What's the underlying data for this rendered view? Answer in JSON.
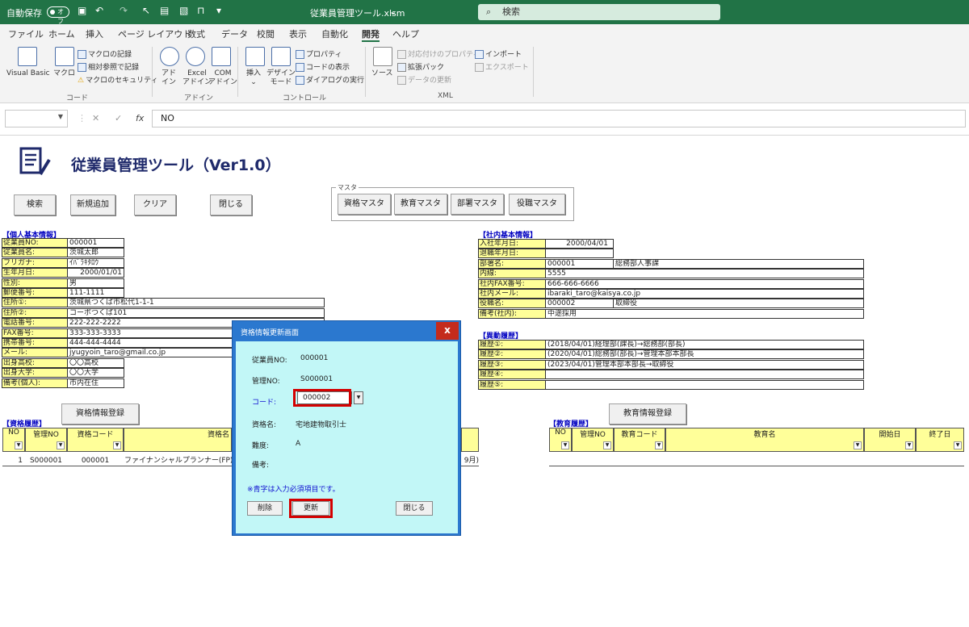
{
  "titlebar": {
    "autosave_label": "自動保存",
    "autosave_state": "オフ",
    "filename": "従業員管理ツール.xlsm",
    "search_placeholder": "検索"
  },
  "ribbon_tabs": [
    "ファイル",
    "ホーム",
    "挿入",
    "ページ レイアウト",
    "数式",
    "データ",
    "校閲",
    "表示",
    "自動化",
    "開発",
    "ヘルプ"
  ],
  "ribbon_active_tab": "開発",
  "ribbon": {
    "code": {
      "visual_basic": "Visual Basic",
      "macro": "マクロ",
      "record_macro": "マクロの記録",
      "relative_ref": "相対参照で記録",
      "macro_security": "マクロのセキュリティ",
      "group_label": "コード"
    },
    "addins": {
      "addin_l1": "アド",
      "addin_l2": "イン",
      "excel_addin_l1": "Excel",
      "excel_addin_l2": "アドイン",
      "com_addin_l1": "COM",
      "com_addin_l2": "アドイン",
      "group_label": "アドイン"
    },
    "controls": {
      "insert": "挿入",
      "design_mode_l1": "デザイン",
      "design_mode_l2": "モード",
      "properties": "プロパティ",
      "view_code": "コードの表示",
      "run_dialog": "ダイアログの実行",
      "group_label": "コントロール"
    },
    "xml": {
      "source": "ソース",
      "map_properties": "対応付けのプロパティ",
      "expansion_pack": "拡張パック",
      "refresh_data": "データの更新",
      "import": "インポート",
      "export": "エクスポート",
      "group_label": "XML"
    }
  },
  "formula_bar": {
    "cancel_glyph": "✕",
    "enter_glyph": "✓",
    "fx_label": "fx",
    "content": "NO"
  },
  "sheet": {
    "app_title": "従業員管理ツール（Ver1.0）",
    "buttons": {
      "search": "検索",
      "new": "新規追加",
      "clear": "クリア",
      "close": "閉じる"
    },
    "master_frame_label": "マスタ",
    "master_buttons": {
      "qualification": "資格マスタ",
      "education": "教育マスタ",
      "department": "部署マスタ",
      "position": "役職マスタ"
    },
    "personal": {
      "title": "【個人基本情報】",
      "rows": [
        {
          "label": "従業員NO:",
          "value": "000001"
        },
        {
          "label": "従業員名:",
          "value": "茨城太郎"
        },
        {
          "label": "フリガナ:",
          "value": "ｲﾊﾞﾗｷﾀﾛｳ"
        },
        {
          "label": "生年月日:",
          "value": "2000/01/01"
        },
        {
          "label": "性別:",
          "value": "男"
        },
        {
          "label": "郵便番号:",
          "value": "111-1111"
        },
        {
          "label": "住所①:",
          "value": "茨城県つくば市松代1-1-1"
        },
        {
          "label": "住所②:",
          "value": "コーポつくば101"
        },
        {
          "label": "電話番号:",
          "value": "222-222-2222"
        },
        {
          "label": "FAX番号:",
          "value": "333-333-3333"
        },
        {
          "label": "携帯番号:",
          "value": "444-444-4444"
        },
        {
          "label": "メール:",
          "value": "jyugyoin_taro@gmail.co.jp"
        },
        {
          "label": "出身高校:",
          "value": "〇〇高校"
        },
        {
          "label": "出身大学:",
          "value": "〇〇大学"
        },
        {
          "label": "備考(個人):",
          "value": "市内在住"
        }
      ]
    },
    "company": {
      "title": "【社内基本情報】",
      "rows": [
        {
          "label": "入社年月日:",
          "value": "2000/04/01",
          "extra": ""
        },
        {
          "label": "退職年月日:",
          "value": "",
          "extra": ""
        },
        {
          "label": "部署名:",
          "value": "000001",
          "extra": "総務部人事課"
        },
        {
          "label": "内線:",
          "value": "5555",
          "extra": ""
        },
        {
          "label": "社内FAX番号:",
          "value": "666-666-6666",
          "extra": ""
        },
        {
          "label": "社内メール:",
          "value": "ibaraki_taro@kaisya.co.jp",
          "extra": ""
        },
        {
          "label": "役職名:",
          "value": "000002",
          "extra": "取締役"
        },
        {
          "label": "備考(社内):",
          "value": "中途採用",
          "extra": ""
        }
      ]
    },
    "transfer": {
      "title": "【異動履歴】",
      "rows": [
        {
          "label": "履歴①:",
          "value": "(2018/04/01)経理部(課長)→総務部(部長)"
        },
        {
          "label": "履歴②:",
          "value": "(2020/04/01)総務部(部長)→管理本部本部長"
        },
        {
          "label": "履歴③:",
          "value": "(2023/04/01)管理本部本部長→取締役"
        },
        {
          "label": "履歴④:",
          "value": ""
        },
        {
          "label": "履歴⑤:",
          "value": ""
        }
      ]
    },
    "qual_register_btn": "資格情報登録",
    "edu_register_btn": "教育情報登録",
    "qual_history": {
      "title": "【資格履歴】",
      "headers": [
        "NO",
        "管理NO",
        "資格コード",
        "資格名"
      ],
      "row": {
        "no": "1",
        "mgmt": "S000001",
        "code": "000001",
        "name": "ファイナンシャルプランナー(FP)",
        "tail": "9月)"
      }
    },
    "edu_history": {
      "title": "【教育履歴】",
      "headers": [
        "NO",
        "管理NO",
        "教育コード",
        "教育名",
        "開始日",
        "終了日"
      ]
    }
  },
  "dialog": {
    "title": "資格情報更新画面",
    "close_glyph": "x",
    "fields": {
      "emp_no_label": "従業員NO:",
      "emp_no": "000001",
      "mgmt_no_label": "管理NO:",
      "mgmt_no": "S000001",
      "code_label": "コード:",
      "code": "000002",
      "qual_name_label": "資格名:",
      "qual_name": "宅地建物取引士",
      "difficulty_label": "難度:",
      "difficulty": "A",
      "note_label": "備考:"
    },
    "required_note": "※青字は入力必須項目です。",
    "buttons": {
      "delete": "削除",
      "update": "更新",
      "close": "閉じる"
    },
    "colors": {
      "frame": "#2b78cf",
      "body": "#c2f7f7",
      "highlight": "#d40000"
    }
  }
}
